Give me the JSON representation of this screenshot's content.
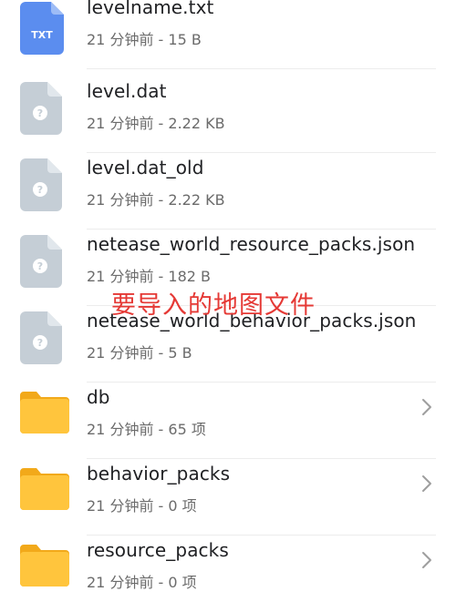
{
  "files": [
    {
      "name": "levelname.txt",
      "meta": "21 分钟前 - 15 B",
      "icon": "txt-file-icon",
      "icon_label": "TXT"
    },
    {
      "name": "level.dat",
      "meta": "21 分钟前 - 2.22 KB",
      "icon": "unknown-file-icon"
    },
    {
      "name": "level.dat_old",
      "meta": "21 分钟前 - 2.22 KB",
      "icon": "unknown-file-icon"
    },
    {
      "name": "netease_world_resource_packs.json",
      "meta": "21 分钟前 - 182 B",
      "icon": "unknown-file-icon"
    },
    {
      "name": "netease_world_behavior_packs.json",
      "meta": "21 分钟前 - 5 B",
      "icon": "unknown-file-icon"
    },
    {
      "name": "db",
      "meta": "21 分钟前 - 65 项",
      "icon": "folder-icon"
    },
    {
      "name": "behavior_packs",
      "meta": "21 分钟前 - 0 项",
      "icon": "folder-icon"
    },
    {
      "name": "resource_packs",
      "meta": "21 分钟前 - 0 项",
      "icon": "folder-icon"
    }
  ],
  "annotation": "要导入的地图文件",
  "colors": {
    "txt_icon": "#5b8def",
    "unknown_icon": "#c5ced6",
    "folder": "#ffc53d",
    "folder_tab": "#f2a91a",
    "annotation": "#e53935"
  }
}
